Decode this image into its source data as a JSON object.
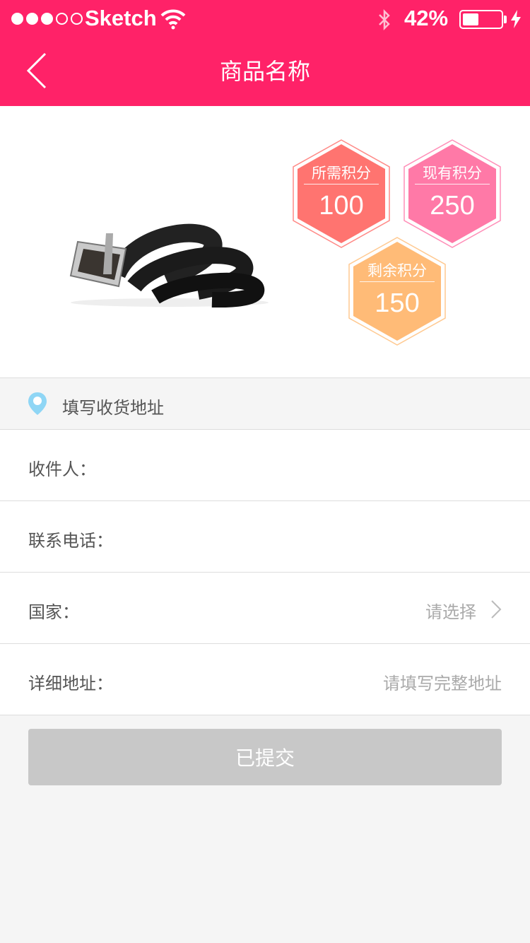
{
  "status_bar": {
    "carrier": "Sketch",
    "battery_text": "42%",
    "battery_level": 0.42,
    "signal_bars_filled": 3,
    "signal_bars_total": 5
  },
  "header": {
    "title": "商品名称",
    "background_color": "#ff2268"
  },
  "points": {
    "required": {
      "label": "所需积分",
      "value": "100",
      "color": "#ff7470"
    },
    "current": {
      "label": "现有积分",
      "value": "250",
      "color": "#ff79a7"
    },
    "remaining": {
      "label": "剩余积分",
      "value": "150",
      "color": "#ffbb77"
    }
  },
  "address_section": {
    "icon": "location-pin-icon",
    "title": "填写收货地址"
  },
  "form": {
    "recipient_label": "收件人：",
    "phone_label": "联系电话：",
    "country_label": "国家：",
    "country_placeholder": "请选择",
    "address_label": "详细地址：",
    "address_placeholder": "请填写完整地址"
  },
  "submit": {
    "label": "已提交"
  }
}
